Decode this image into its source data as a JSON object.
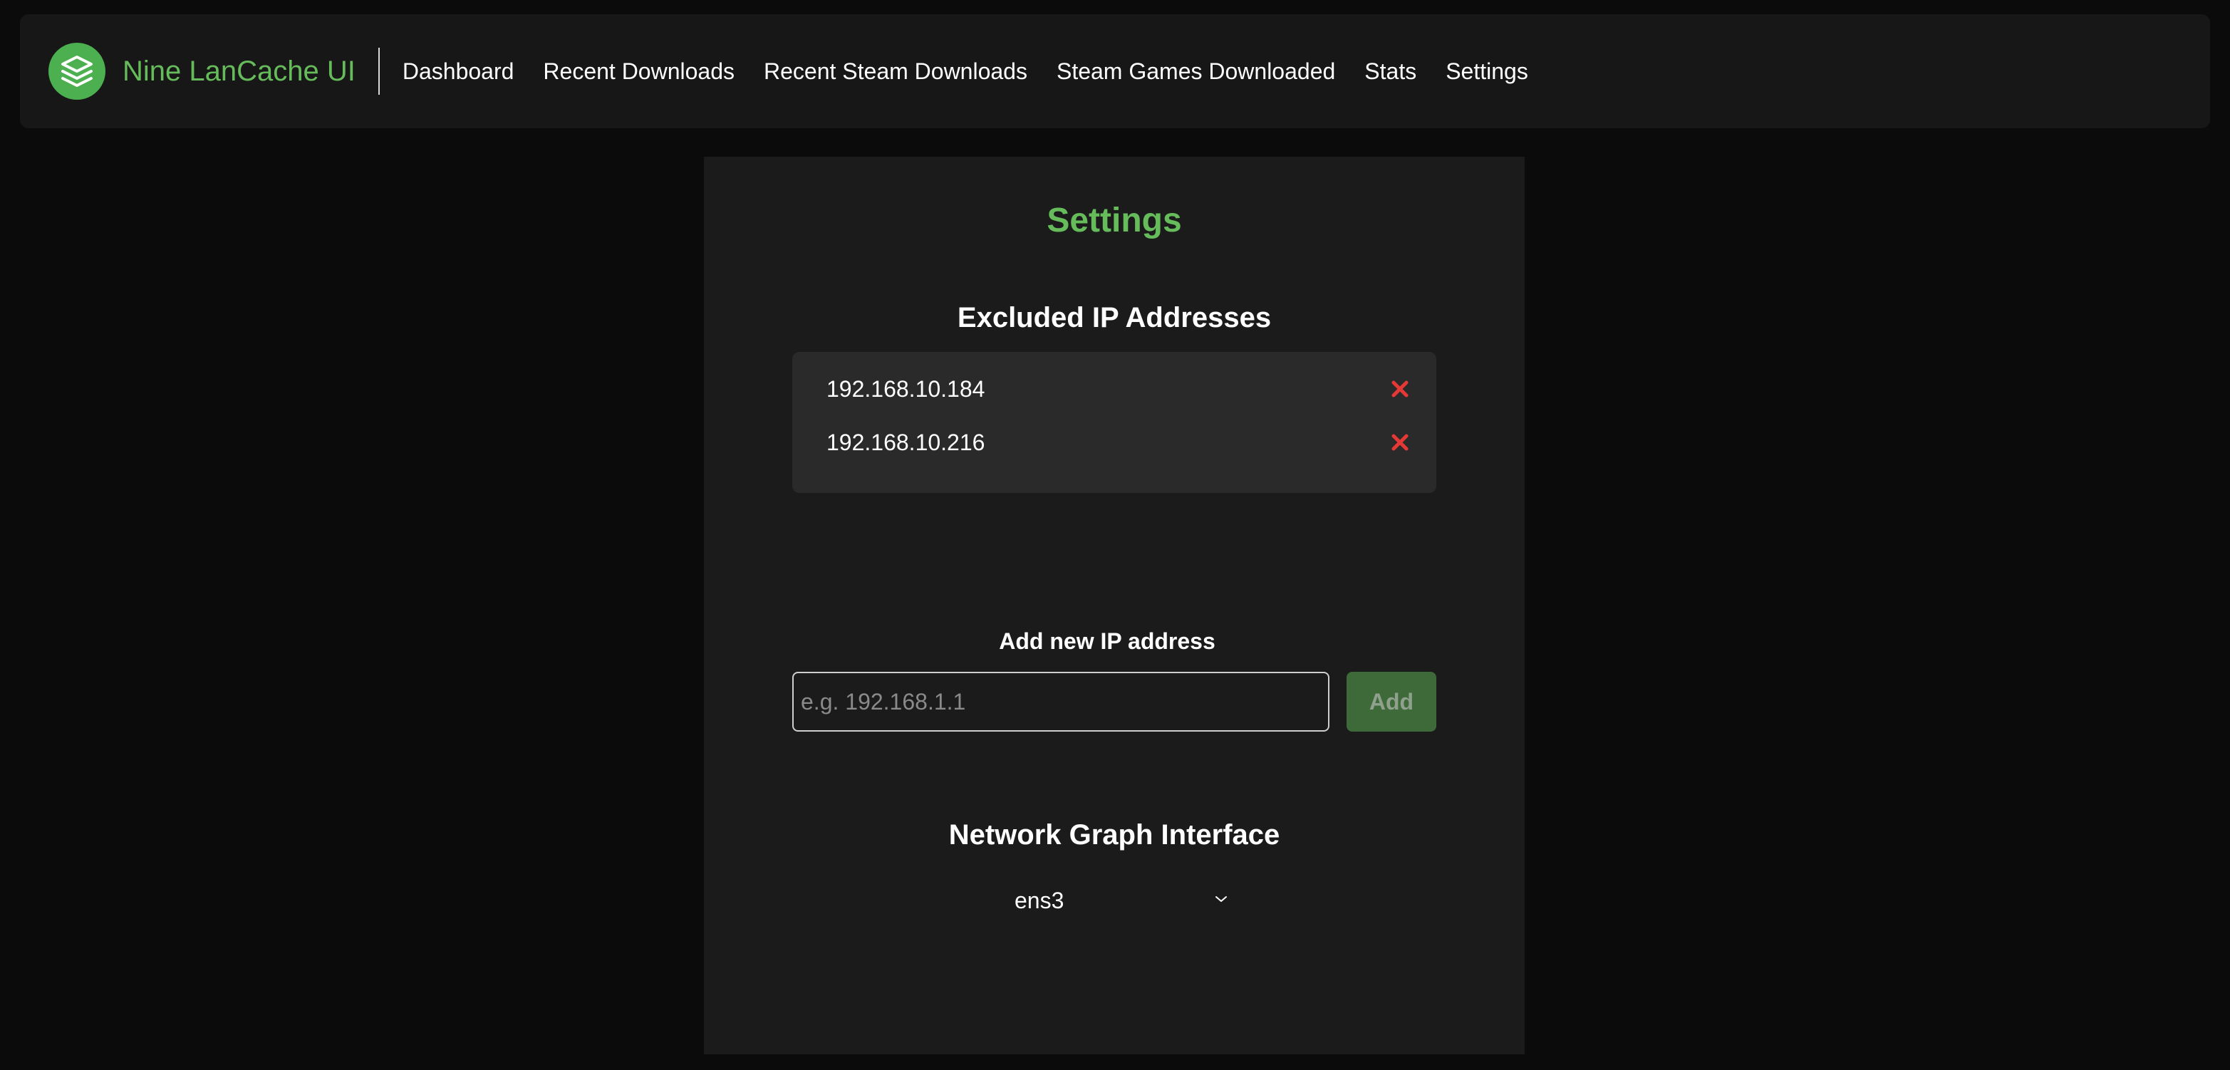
{
  "brand": {
    "logo_icon": "stacked-layers-icon",
    "name": "Nine LanCache UI",
    "accent_color": "#66bb5a"
  },
  "nav": {
    "items": [
      {
        "label": "Dashboard"
      },
      {
        "label": "Recent Downloads"
      },
      {
        "label": "Recent Steam Downloads"
      },
      {
        "label": "Steam Games Downloaded"
      },
      {
        "label": "Stats"
      },
      {
        "label": "Settings"
      }
    ]
  },
  "settings": {
    "title": "Settings",
    "excluded": {
      "heading": "Excluded IP Addresses",
      "remove_icon": "close-icon",
      "remove_color": "#e53935",
      "ips": [
        "192.168.10.184",
        "192.168.10.216"
      ]
    },
    "add": {
      "label": "Add new IP address",
      "placeholder": "e.g. 192.168.1.1",
      "value": "",
      "button_label": "Add"
    },
    "network": {
      "heading": "Network Graph Interface",
      "selected": "ens3",
      "dropdown_icon": "chevron-down-icon"
    }
  }
}
